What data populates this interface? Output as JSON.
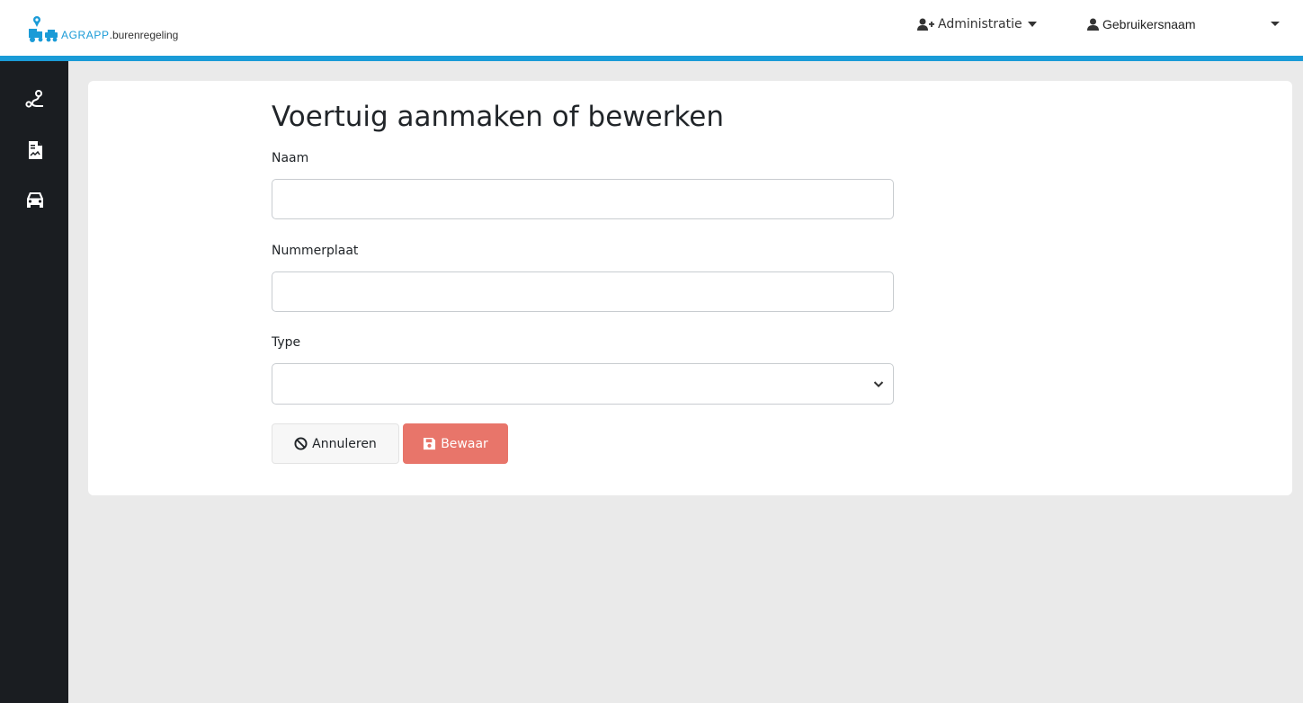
{
  "app": {
    "brand_name": "AGRAPP",
    "brand_sub": ".burenregeling"
  },
  "header": {
    "admin_label": "Administratie",
    "user_label": "Gebruikersnaam"
  },
  "sidebar": {
    "items": [
      {
        "icon": "route-icon"
      },
      {
        "icon": "document-icon"
      },
      {
        "icon": "car-icon"
      }
    ]
  },
  "form": {
    "title": "Voertuig aanmaken of bewerken",
    "name_label": "Naam",
    "name_value": "",
    "plate_label": "Nummerplaat",
    "plate_value": "",
    "type_label": "Type",
    "type_value": "",
    "cancel_label": "Annuleren",
    "save_label": "Bewaar"
  },
  "colors": {
    "accent": "#1a9bd7",
    "sidebar_bg": "#1a1d21",
    "save_button": "#e8756a",
    "page_bg": "#eaeaea"
  }
}
